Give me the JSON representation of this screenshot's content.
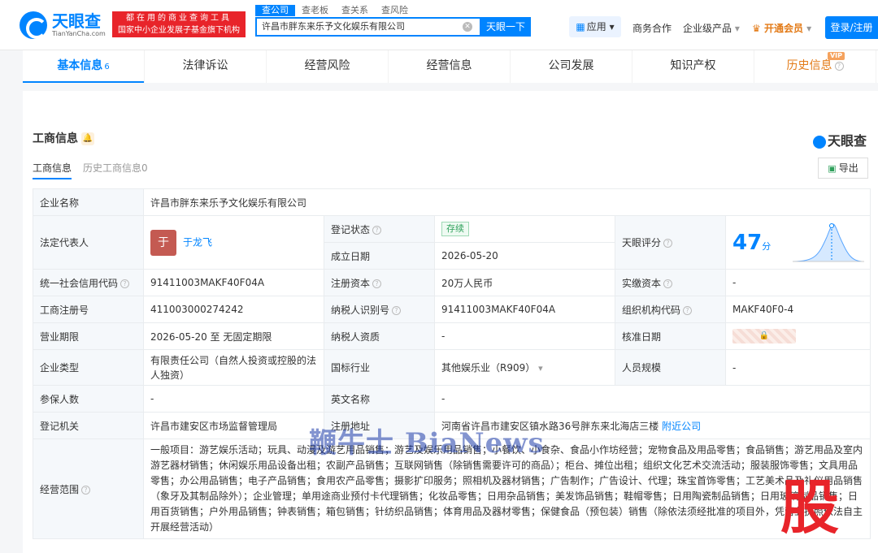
{
  "header": {
    "logo_cn": "天眼查",
    "logo_en": "TianYanCha.com",
    "slogan_line1": "都在用的商业查询工具",
    "slogan_line2": "国家中小企业发展子基金旗下机构",
    "search_tabs": [
      "查公司",
      "查老板",
      "查关系",
      "查风险"
    ],
    "search_value": "许昌市胖东来乐予文化娱乐有限公司",
    "search_button": "天眼一下",
    "apps": "应用",
    "business": "商务合作",
    "enterprise": "企业级产品",
    "vip": "开通会员",
    "login": "登录/注册"
  },
  "main_tabs": {
    "basic": "基本信息",
    "basic_count": "6",
    "legal": "法律诉讼",
    "risk": "经营风险",
    "operation": "经营信息",
    "development": "公司发展",
    "ip": "知识产权",
    "history": "历史信息",
    "vip_badge": "VIP"
  },
  "section": {
    "title": "工商信息",
    "brand": "天眼查",
    "tab_current": "工商信息",
    "tab_history": "历史工商信息0",
    "export": "导出"
  },
  "info": {
    "company_name_label": "企业名称",
    "company_name": "许昌市胖东来乐予文化娱乐有限公司",
    "legal_rep_label": "法定代表人",
    "legal_rep_avatar": "于",
    "legal_rep": "于龙飞",
    "reg_status_label": "登记状态",
    "reg_status": "存续",
    "found_date_label": "成立日期",
    "found_date": "2026-05-20",
    "score_label": "天眼评分",
    "score": "47",
    "score_unit": "分",
    "credit_code_label": "统一社会信用代码",
    "credit_code": "91411003MAKF40F04A",
    "reg_capital_label": "注册资本",
    "reg_capital": "20万人民币",
    "paid_capital_label": "实缴资本",
    "paid_capital": "-",
    "reg_no_label": "工商注册号",
    "reg_no": "411003000274242",
    "taxpayer_id_label": "纳税人识别号",
    "taxpayer_id": "91411003MAKF40F04A",
    "org_code_label": "组织机构代码",
    "org_code": "MAKF40F0-4",
    "term_label": "营业期限",
    "term": "2026-05-20 至 无固定期限",
    "taxpayer_qual_label": "纳税人资质",
    "taxpayer_qual": "-",
    "approve_date_label": "核准日期",
    "type_label": "企业类型",
    "type": "有限责任公司（自然人投资或控股的法人独资）",
    "industry_label": "国标行业",
    "industry": "其他娱乐业（R909）",
    "staff_label": "人员规模",
    "staff": "-",
    "insured_label": "参保人数",
    "insured": "-",
    "en_name_label": "英文名称",
    "en_name": "-",
    "authority_label": "登记机关",
    "authority": "许昌市建安区市场监督管理局",
    "address_label": "注册地址",
    "address": "河南省许昌市建安区镇水路36号胖东来北海店三楼",
    "nearby": "附近公司",
    "scope_label": "经营范围",
    "scope": "一般项目：游艺娱乐活动；玩具、动漫及游艺用品销售；游艺及娱乐用品销售；小餐饮、小食杂、食品小作坊经营；宠物食品及用品零售；食品销售；游艺用品及室内游艺器材销售；休闲娱乐用品设备出租；农副产品销售；互联网销售（除销售需要许可的商品）；柜台、摊位出租；组织文化艺术交流活动；服装服饰零售；文具用品零售；办公用品销售；电子产品销售；食用农产品零售；摄影扩印服务；照相机及器材销售；广告制作；广告设计、代理；珠宝首饰零售；工艺美术品及礼仪用品销售（象牙及其制品除外）；企业管理；单用途商业预付卡代理销售；化妆品零售；日用杂品销售；美发饰品销售；鞋帽零售；日用陶瓷制品销售；日用玻璃制品销售；日用百货销售；户外用品销售；钟表销售；箱包销售；针纺织品销售；体育用品及器材零售；保健食品（预包装）销售（除依法须经批准的项目外，凭营业执照依法自主开展经营活动）"
  },
  "watermark": {
    "text": "鞭牛士 BiaNews",
    "stock": "股"
  },
  "colors": {
    "accent": "#0084ff",
    "vip": "#e37b18",
    "status_green": "#2ea05b"
  }
}
